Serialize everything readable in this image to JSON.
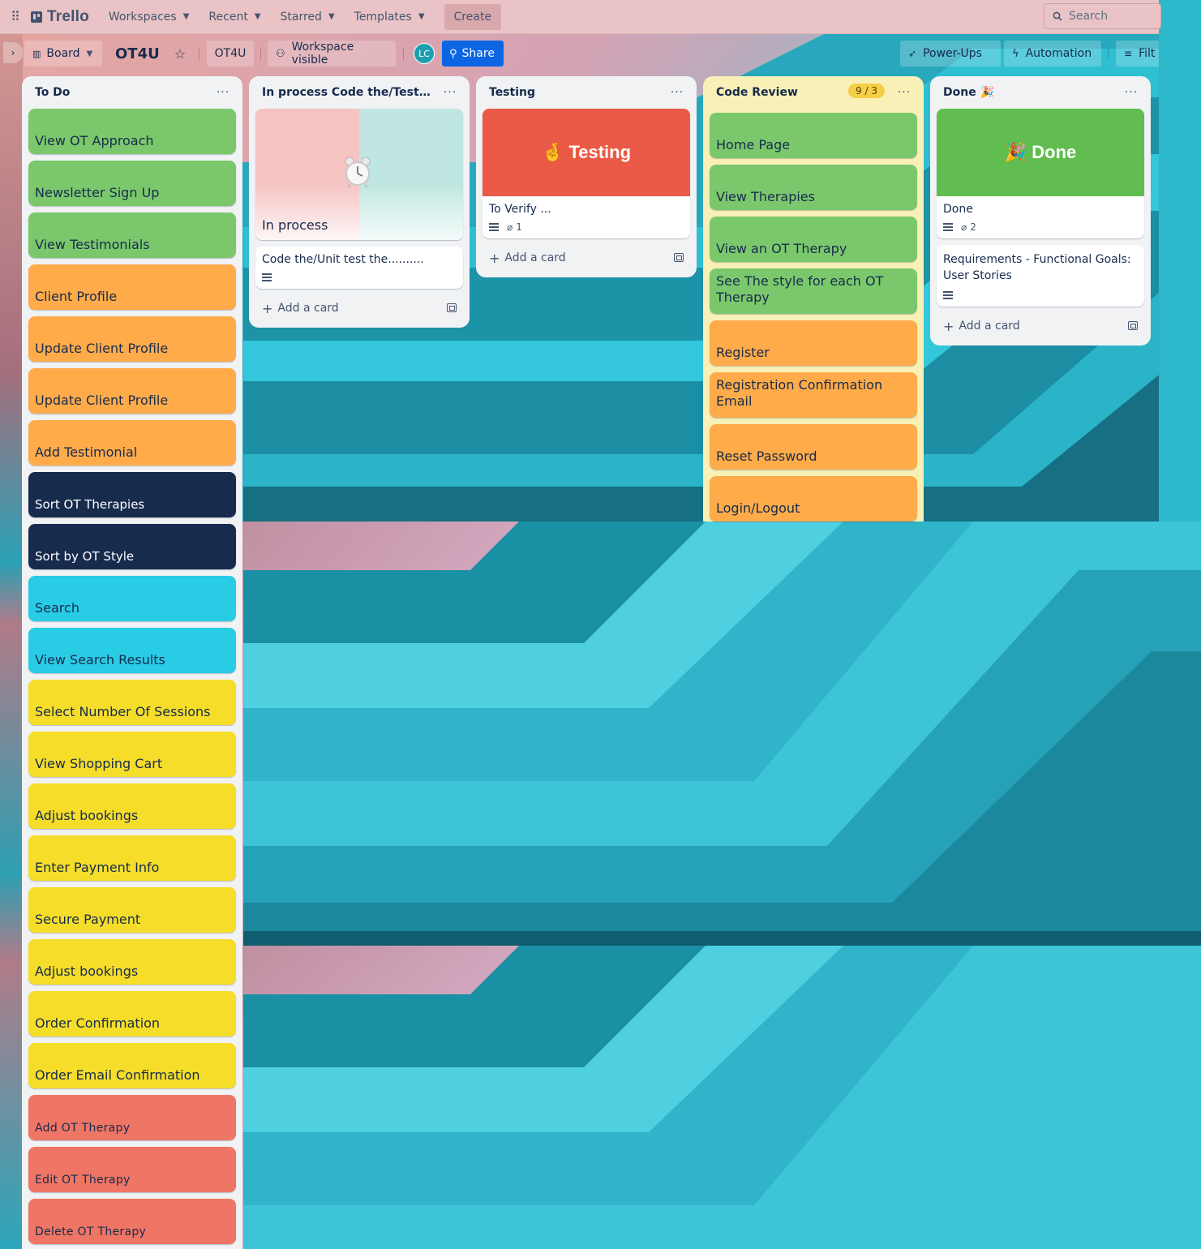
{
  "topnav": {
    "brand": "Trello",
    "menu": [
      {
        "label": "Workspaces"
      },
      {
        "label": "Recent"
      },
      {
        "label": "Starred"
      },
      {
        "label": "Templates"
      }
    ],
    "create_label": "Create",
    "search_placeholder": "Search"
  },
  "board": {
    "view_label": "Board",
    "name": "OT4U",
    "workspace_label": "OT4U",
    "visibility_label": "Workspace visible",
    "avatar_initials": "LC",
    "share_label": "Share",
    "powerups_label": "Power-Ups",
    "automation_label": "Automation",
    "filter_label": "Filt"
  },
  "lists": {
    "todo": {
      "title": "To Do",
      "cards": [
        {
          "title": "View OT Approach",
          "color": "#7bc86c"
        },
        {
          "title": "Newsletter Sign Up",
          "color": "#7bc86c"
        },
        {
          "title": "View Testimonials",
          "color": "#7bc86c"
        },
        {
          "title": "Client Profile",
          "color": "#ffab4a"
        },
        {
          "title": "Update Client Profile",
          "color": "#ffab4a"
        },
        {
          "title": "Update Client Profile",
          "color": "#ffab4a"
        },
        {
          "title": "Add Testimonial",
          "color": "#ffab4a"
        },
        {
          "title": "Sort OT Therapies",
          "color": "#172b4d"
        },
        {
          "title": "Sort by OT Style",
          "color": "#172b4d"
        },
        {
          "title": "Search",
          "color": "#29cce5"
        },
        {
          "title": "View Search Results",
          "color": "#29cce5"
        },
        {
          "title": "Select Number Of Sessions",
          "color": "#f5dd29"
        },
        {
          "title": "View Shopping Cart",
          "color": "#f5dd29"
        },
        {
          "title": "Adjust bookings",
          "color": "#f5dd29"
        },
        {
          "title": "Enter Payment Info",
          "color": "#f5dd29"
        },
        {
          "title": "Secure Payment",
          "color": "#f5dd29"
        },
        {
          "title": "Adjust bookings",
          "color": "#f5dd29"
        },
        {
          "title": "Order Confirmation",
          "color": "#f5dd29"
        },
        {
          "title": "Order Email Confirmation",
          "color": "#f5dd29"
        },
        {
          "title": "Add OT Therapy",
          "color": "#ef7564"
        },
        {
          "title": "Edit OT Therapy",
          "color": "#ef7564"
        },
        {
          "title": "Delete OT Therapy",
          "color": "#ef7564"
        }
      ]
    },
    "inprocess": {
      "title": "In process Code the/Test the....",
      "cover_card_title": "In process",
      "card_title": "Code the/Unit test the..........",
      "add_label": "Add a card"
    },
    "testing": {
      "title": "Testing",
      "cover_text": "🤞 Testing",
      "cover_color": "#eb5a46",
      "card_title": "To Verify ...",
      "attachments": "1",
      "add_label": "Add a card"
    },
    "codereview": {
      "title": "Code Review",
      "limit_badge": "9 / 3",
      "cards": [
        {
          "title": "Home Page",
          "color": "#7bc86c"
        },
        {
          "title": "View Therapies",
          "color": "#7bc86c"
        },
        {
          "title": "View an OT Therapy",
          "color": "#7bc86c"
        },
        {
          "title": "See The style for each OT Therapy",
          "color": "#7bc86c"
        },
        {
          "title": "Register",
          "color": "#ffab4a"
        },
        {
          "title": "Registration Confirmation Email",
          "color": "#ffab4a"
        },
        {
          "title": "Reset Password",
          "color": "#ffab4a"
        },
        {
          "title": "Login/Logout",
          "color": "#ffab4a"
        }
      ]
    },
    "done": {
      "title": "Done 🎉",
      "cover_text": "🎉 Done",
      "cover_color": "#61bd4f",
      "card_title": "Done",
      "attachments": "2",
      "card2_title": "Requirements - Functional Goals: User Stories",
      "add_label": "Add a card"
    }
  }
}
